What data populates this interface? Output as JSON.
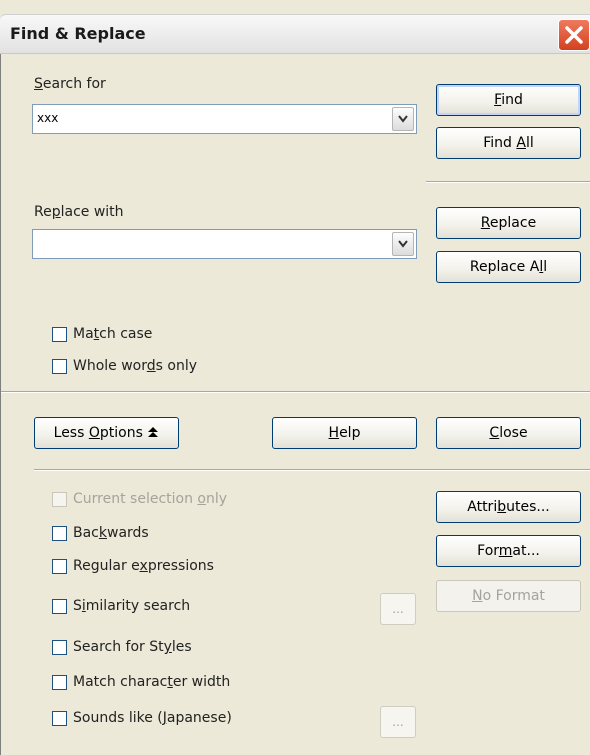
{
  "window": {
    "title": "Find & Replace"
  },
  "search": {
    "label_pre": "",
    "label_u": "S",
    "label_post": "earch for",
    "value": "xxx"
  },
  "replace": {
    "label_pre": "Re",
    "label_u": "p",
    "label_post": "lace with",
    "value": ""
  },
  "buttons": {
    "find": {
      "pre": "",
      "u": "F",
      "post": "ind"
    },
    "find_all": {
      "pre": "Find ",
      "u": "A",
      "post": "ll"
    },
    "replace": {
      "pre": "",
      "u": "R",
      "post": "eplace"
    },
    "replace_all": {
      "pre": "Replace A",
      "u": "l",
      "post": "l"
    },
    "less_options": {
      "pre": "Less ",
      "u": "O",
      "post": "ptions"
    },
    "help": {
      "pre": "",
      "u": "H",
      "post": "elp"
    },
    "close": {
      "pre": "",
      "u": "C",
      "post": "lose"
    },
    "attributes": {
      "pre": "Attri",
      "u": "b",
      "post": "utes..."
    },
    "format": {
      "pre": "For",
      "u": "m",
      "post": "at..."
    },
    "no_format": {
      "pre": "",
      "u": "N",
      "post": "o Format"
    },
    "similarity_dots": "...",
    "sounds_dots": "..."
  },
  "options": {
    "match_case": {
      "pre": "Ma",
      "u": "t",
      "post": "ch case",
      "checked": false
    },
    "whole_words": {
      "pre": "Whole wor",
      "u": "d",
      "post": "s only",
      "checked": false
    },
    "current_selection": {
      "pre": "Current selection ",
      "u": "o",
      "post": "nly",
      "checked": false,
      "disabled": true
    },
    "backwards": {
      "pre": "Bac",
      "u": "k",
      "post": "wards",
      "checked": false
    },
    "regex": {
      "pre": "Regular e",
      "u": "x",
      "post": "pressions",
      "checked": false
    },
    "similarity": {
      "pre": "S",
      "u": "i",
      "post": "milarity search",
      "checked": false
    },
    "styles": {
      "pre": "Search for St",
      "u": "y",
      "post": "les",
      "checked": false
    },
    "char_width": {
      "pre": "Match charac",
      "u": "t",
      "post": "er width",
      "checked": false
    },
    "sounds_like": {
      "pre": "Sounds like (",
      "u": "J",
      "post": "apanese)",
      "checked": false
    }
  }
}
